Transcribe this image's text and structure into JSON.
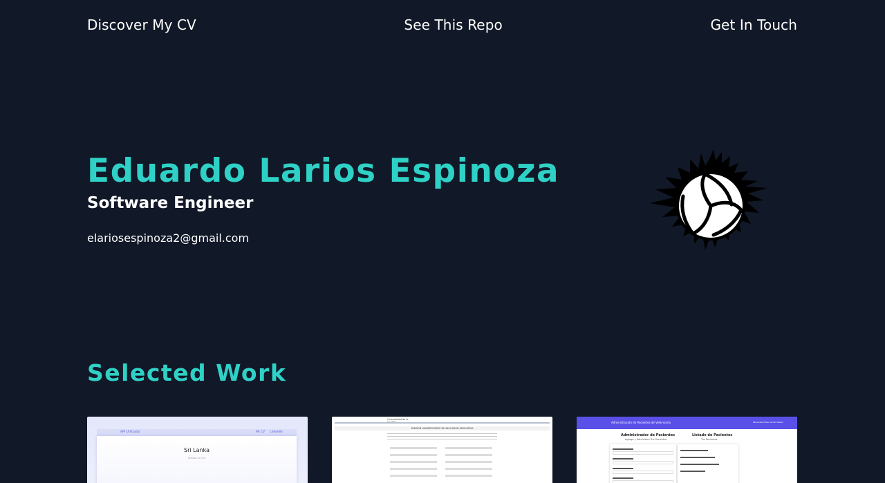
{
  "nav": {
    "cv": "Discover My CV",
    "repo": "See This Repo",
    "contact": "Get In Touch"
  },
  "hero": {
    "name": "Eduardo Larios Espinoza",
    "role": "Software Engineer",
    "email": "elariosespinoza2@gmail.com",
    "image": "volleyball-icon"
  },
  "work": {
    "title": "Selected Work",
    "cards": [
      {
        "nav_left": "API Utilizada",
        "nav_right_1": "Mi CV",
        "nav_right_2": "LinkedIn",
        "title": "Sri Lanka",
        "subtitle": "Analiza el CSV"
      },
      {
        "logo": "Universidad de la Ciudad",
        "heading": "PADRÓN UNIVERSITARIO DE INCLUSIÓN EDUCATIVA"
      },
      {
        "topbar": "Administración de Pacientes de Veterinaria",
        "topbar_links": "Pacientes  Citas  Cerrar Sesión",
        "left_heading": "Administrador de Pacientes",
        "left_sub": "Agrega y Administra Tus Pacientes",
        "right_heading": "Listado de Pacientes",
        "right_sub": "Tus Pacientes"
      }
    ]
  },
  "colors": {
    "background": "#111827",
    "accent": "#2fd1c6",
    "text": "#ffffff"
  }
}
